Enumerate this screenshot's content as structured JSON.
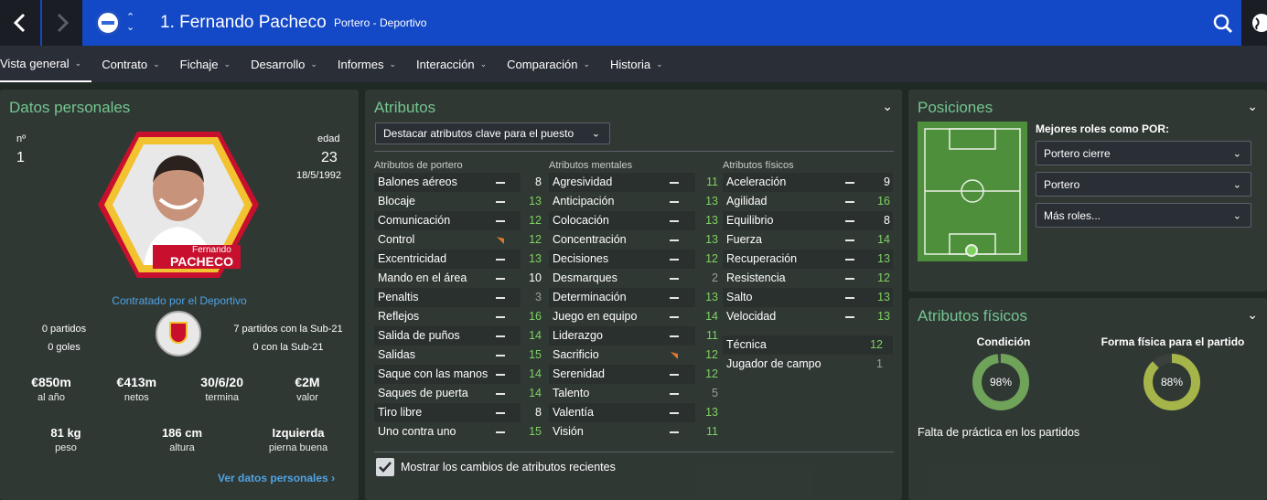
{
  "header": {
    "player_title": "1. Fernando Pacheco",
    "subtitle": "Portero - Deportivo",
    "club_short": "ud"
  },
  "menu": [
    "Vista general",
    "Contrato",
    "Fichaje",
    "Desarrollo",
    "Informes",
    "Interacción",
    "Comparación",
    "Historia"
  ],
  "personal": {
    "title": "Datos personales",
    "number_label": "nº",
    "number": "1",
    "age_label": "edad",
    "age": "23",
    "dob": "18/5/1992",
    "card_first": "Fernando",
    "card_last": "PACHECO",
    "contracted": "Contratado por el Deportivo",
    "left_lines": [
      "0 partidos",
      "0 goles"
    ],
    "right_lines": [
      "7 partidos con la Sub-21",
      "0 con la Sub-21"
    ],
    "stats": [
      {
        "v": "€850m",
        "l": "al año"
      },
      {
        "v": "€413m",
        "l": "netos"
      },
      {
        "v": "30/6/20",
        "l": "termina"
      },
      {
        "v": "€2M",
        "l": "valor"
      }
    ],
    "body": [
      {
        "v": "81 kg",
        "l": "peso"
      },
      {
        "v": "186 cm",
        "l": "altura"
      },
      {
        "v": "Izquierda",
        "l": "pierna buena"
      }
    ],
    "more_link": "Ver datos personales"
  },
  "attributes": {
    "title": "Atributos",
    "highlight_select": "Destacar atributos clave para el puesto",
    "gk_header": "Atributos de portero",
    "mental_header": "Atributos mentales",
    "physical_header": "Atributos físicos",
    "gk": [
      {
        "n": "Balones aéreos",
        "v": "8",
        "c": "w",
        "t": "dash"
      },
      {
        "n": "Blocaje",
        "v": "13",
        "c": "g",
        "t": "dash"
      },
      {
        "n": "Comunicación",
        "v": "12",
        "c": "g",
        "t": "dash"
      },
      {
        "n": "Control",
        "v": "12",
        "c": "g",
        "t": "up"
      },
      {
        "n": "Excentricidad",
        "v": "13",
        "c": "g",
        "t": "dash"
      },
      {
        "n": "Mando en el área",
        "v": "10",
        "c": "w",
        "t": "dash"
      },
      {
        "n": "Penaltis",
        "v": "3",
        "c": "gr",
        "t": "dash"
      },
      {
        "n": "Reflejos",
        "v": "16",
        "c": "g",
        "t": "dash"
      },
      {
        "n": "Salida de puños",
        "v": "14",
        "c": "g",
        "t": "dash"
      },
      {
        "n": "Salidas",
        "v": "15",
        "c": "g",
        "t": "dash"
      },
      {
        "n": "Saque con las manos",
        "v": "14",
        "c": "g",
        "t": "dash"
      },
      {
        "n": "Saques de puerta",
        "v": "14",
        "c": "g",
        "t": "dash"
      },
      {
        "n": "Tiro libre",
        "v": "8",
        "c": "w",
        "t": "dash"
      },
      {
        "n": "Uno contra uno",
        "v": "15",
        "c": "g",
        "t": "dash"
      }
    ],
    "mental": [
      {
        "n": "Agresividad",
        "v": "11",
        "c": "g",
        "t": "dash"
      },
      {
        "n": "Anticipación",
        "v": "13",
        "c": "g",
        "t": "dash"
      },
      {
        "n": "Colocación",
        "v": "13",
        "c": "g",
        "t": "dash"
      },
      {
        "n": "Concentración",
        "v": "13",
        "c": "g",
        "t": "dash"
      },
      {
        "n": "Decisiones",
        "v": "12",
        "c": "g",
        "t": "dash"
      },
      {
        "n": "Desmarques",
        "v": "2",
        "c": "gr",
        "t": "dash"
      },
      {
        "n": "Determinación",
        "v": "13",
        "c": "g",
        "t": "dash"
      },
      {
        "n": "Juego en equipo",
        "v": "14",
        "c": "g",
        "t": "dash"
      },
      {
        "n": "Liderazgo",
        "v": "11",
        "c": "g",
        "t": "dash"
      },
      {
        "n": "Sacrificio",
        "v": "12",
        "c": "g",
        "t": "up"
      },
      {
        "n": "Serenidad",
        "v": "12",
        "c": "g",
        "t": "dash"
      },
      {
        "n": "Talento",
        "v": "5",
        "c": "gr",
        "t": "dash"
      },
      {
        "n": "Valentía",
        "v": "13",
        "c": "g",
        "t": "dash"
      },
      {
        "n": "Visión",
        "v": "11",
        "c": "g",
        "t": "dash"
      }
    ],
    "physical": [
      {
        "n": "Aceleración",
        "v": "9",
        "c": "w",
        "t": "dash"
      },
      {
        "n": "Agilidad",
        "v": "16",
        "c": "g",
        "t": "dash"
      },
      {
        "n": "Equilibrio",
        "v": "8",
        "c": "w",
        "t": "dash"
      },
      {
        "n": "Fuerza",
        "v": "14",
        "c": "g",
        "t": "dash"
      },
      {
        "n": "Recuperación",
        "v": "13",
        "c": "g",
        "t": "dash"
      },
      {
        "n": "Resistencia",
        "v": "12",
        "c": "g",
        "t": "dash"
      },
      {
        "n": "Salto",
        "v": "13",
        "c": "g",
        "t": "dash"
      },
      {
        "n": "Velocidad",
        "v": "13",
        "c": "g",
        "t": "dash"
      }
    ],
    "extra": [
      {
        "n": "Técnica",
        "v": "12",
        "c": "g"
      },
      {
        "n": "Jugador de campo",
        "v": "1",
        "c": "gr"
      }
    ],
    "show_changes": "Mostrar los cambios de atributos recientes"
  },
  "positions": {
    "title": "Posiciones",
    "roles_title": "Mejores roles como POR:",
    "roles": [
      "Portero cierre",
      "Portero",
      "Más roles..."
    ]
  },
  "physical_panel": {
    "title": "Atributos físicos",
    "condition_label": "Condición",
    "condition": "98%",
    "condition_value": 98,
    "fitness_label": "Forma física para el partido",
    "fitness": "88%",
    "fitness_value": 88,
    "note": "Falta de práctica en los partidos"
  },
  "colors": {
    "accent_blue": "#1348c6",
    "good": "#7fd162",
    "title_green": "#74c690",
    "ring_green": "#6fa35a",
    "ring_olive": "#a6b54a",
    "trend_up": "#e0762e"
  }
}
